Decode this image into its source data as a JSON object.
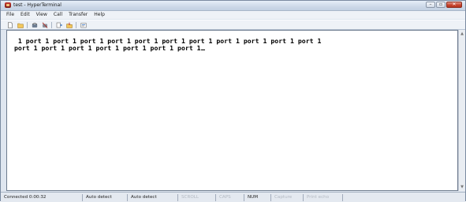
{
  "window": {
    "title": "test - HyperTerminal",
    "controls": {
      "minimize": "–",
      "maximize": "▫",
      "close": "✕"
    }
  },
  "menu": {
    "items": [
      "File",
      "Edit",
      "View",
      "Call",
      "Transfer",
      "Help"
    ]
  },
  "toolbar": {
    "buttons": [
      {
        "icon": "new-connection-icon"
      },
      {
        "icon": "open-icon"
      },
      {
        "icon": "dial-icon"
      },
      {
        "icon": "disconnect-icon"
      },
      {
        "icon": "send-icon"
      },
      {
        "icon": "receive-icon"
      },
      {
        "icon": "properties-icon"
      }
    ]
  },
  "terminal": {
    "lines": [
      " 1 port 1 port 1 port 1 port 1 port 1 port 1 port 1 port 1 port 1 port 1 port 1",
      "port 1 port 1 port 1 port 1 port 1 port 1 port 1"
    ]
  },
  "status": {
    "connected": "Connected 0:00:32",
    "detect1": "Auto detect",
    "detect2": "Auto detect",
    "scroll": "SCROLL",
    "caps": "CAPS",
    "num": "NUM",
    "capture": "Capture",
    "print_echo": "Print echo"
  },
  "colors": {
    "inactive_status_text": "#b3b9c2",
    "close_button": "#c7452f"
  }
}
